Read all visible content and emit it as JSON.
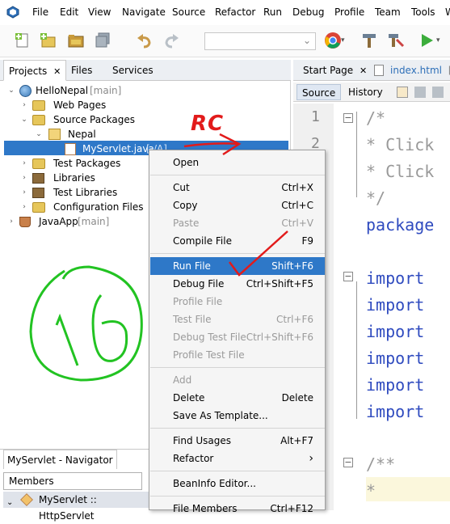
{
  "menubar": {
    "items": [
      "File",
      "Edit",
      "View",
      "Navigate",
      "Source",
      "Refactor",
      "Run",
      "Debug",
      "Profile",
      "Team",
      "Tools",
      "W"
    ]
  },
  "toolbar": {
    "icons": [
      "new-file-icon",
      "new-project-icon",
      "open-project-icon",
      "save-all-icon",
      "undo-icon",
      "redo-icon",
      "chrome-icon",
      "clean-build-icon",
      "build-icon",
      "run-icon"
    ]
  },
  "projects_panel": {
    "tabs": [
      "Projects",
      "Files",
      "Services"
    ],
    "tree": [
      {
        "label": "HelloNepal",
        "suffix": "[main]"
      },
      {
        "label": "Web Pages"
      },
      {
        "label": "Source Packages"
      },
      {
        "label": "Nepal"
      },
      {
        "label": "MyServlet.java",
        "suffix": "[-/A]"
      },
      {
        "label": "Test Packages"
      },
      {
        "label": "Libraries"
      },
      {
        "label": "Test Libraries"
      },
      {
        "label": "Configuration Files"
      },
      {
        "label": "JavaApp",
        "suffix": "[main]"
      }
    ]
  },
  "editor": {
    "tabs": [
      "Start Page",
      "index.html",
      "[-/"
    ],
    "subtabs": [
      "Source",
      "History"
    ],
    "line_numbers": [
      "1",
      "2"
    ],
    "lines": [
      "/*",
      " * Click",
      " * Click",
      " */",
      "package",
      "import",
      "import",
      "import",
      "import",
      "import",
      "import",
      "/**",
      " *"
    ]
  },
  "context_menu": {
    "items": [
      {
        "label": "Open",
        "shortcut": ""
      },
      {
        "label": "Cut",
        "shortcut": "Ctrl+X"
      },
      {
        "label": "Copy",
        "shortcut": "Ctrl+C"
      },
      {
        "label": "Paste",
        "shortcut": "Ctrl+V"
      },
      {
        "label": "Compile File",
        "shortcut": "F9"
      },
      {
        "label": "Run File",
        "shortcut": "Shift+F6"
      },
      {
        "label": "Debug File",
        "shortcut": "Ctrl+Shift+F5"
      },
      {
        "label": "Profile File",
        "shortcut": ""
      },
      {
        "label": "Test File",
        "shortcut": "Ctrl+F6"
      },
      {
        "label": "Debug Test File",
        "shortcut": "Ctrl+Shift+F6"
      },
      {
        "label": "Profile Test File",
        "shortcut": ""
      },
      {
        "label": "Add",
        "shortcut": ""
      },
      {
        "label": "Delete",
        "shortcut": "Delete"
      },
      {
        "label": "Save As Template...",
        "shortcut": ""
      },
      {
        "label": "Find Usages",
        "shortcut": "Alt+F7"
      },
      {
        "label": "Refactor",
        "shortcut": ""
      },
      {
        "label": "BeanInfo Editor...",
        "shortcut": ""
      },
      {
        "label": "File Members",
        "shortcut": "Ctrl+F12"
      }
    ],
    "highlighted": "Run File",
    "disabled": [
      "Paste",
      "Profile File",
      "Test File",
      "Debug Test File",
      "Profile Test File",
      "Add"
    ]
  },
  "navigator": {
    "title": "MyServlet - Navigator",
    "combo_value": "Members",
    "row_label": "MyServlet :: HttpServlet"
  },
  "annotations": {
    "rc_label": "RC",
    "number_label": "16"
  },
  "colors": {
    "selection": "#2e78c8",
    "annotation_red": "#e21b1b",
    "annotation_green": "#22c322",
    "keyword_blue": "#2f4bbf"
  }
}
